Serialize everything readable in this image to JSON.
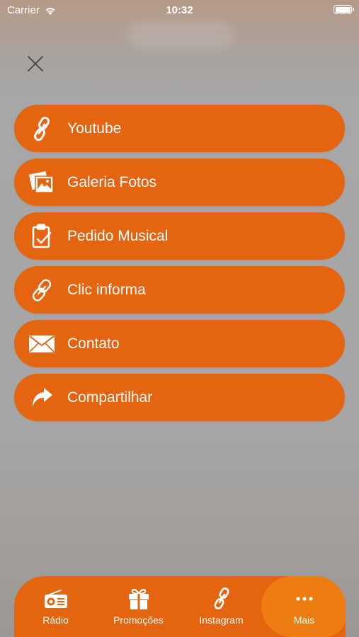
{
  "status_bar": {
    "carrier": "Carrier",
    "time": "10:32"
  },
  "menu": {
    "items": [
      {
        "label": "Youtube",
        "icon": "link-icon"
      },
      {
        "label": "Galeria Fotos",
        "icon": "photos-icon"
      },
      {
        "label": "Pedido Musical",
        "icon": "clipboard-check-icon"
      },
      {
        "label": "Clic informa",
        "icon": "link-icon"
      },
      {
        "label": "Contato",
        "icon": "mail-icon"
      },
      {
        "label": "Compartilhar",
        "icon": "share-icon"
      }
    ]
  },
  "tab_bar": {
    "tabs": [
      {
        "label": "Rádio",
        "icon": "radio-icon"
      },
      {
        "label": "Promoções",
        "icon": "gift-icon"
      },
      {
        "label": "Instagram",
        "icon": "link-icon"
      },
      {
        "label": "Mais",
        "icon": "more-icon",
        "active": true
      }
    ]
  },
  "colors": {
    "accent": "#e5640f",
    "active_tab": "#ee7d11",
    "overlay": "#a6a6a6"
  }
}
